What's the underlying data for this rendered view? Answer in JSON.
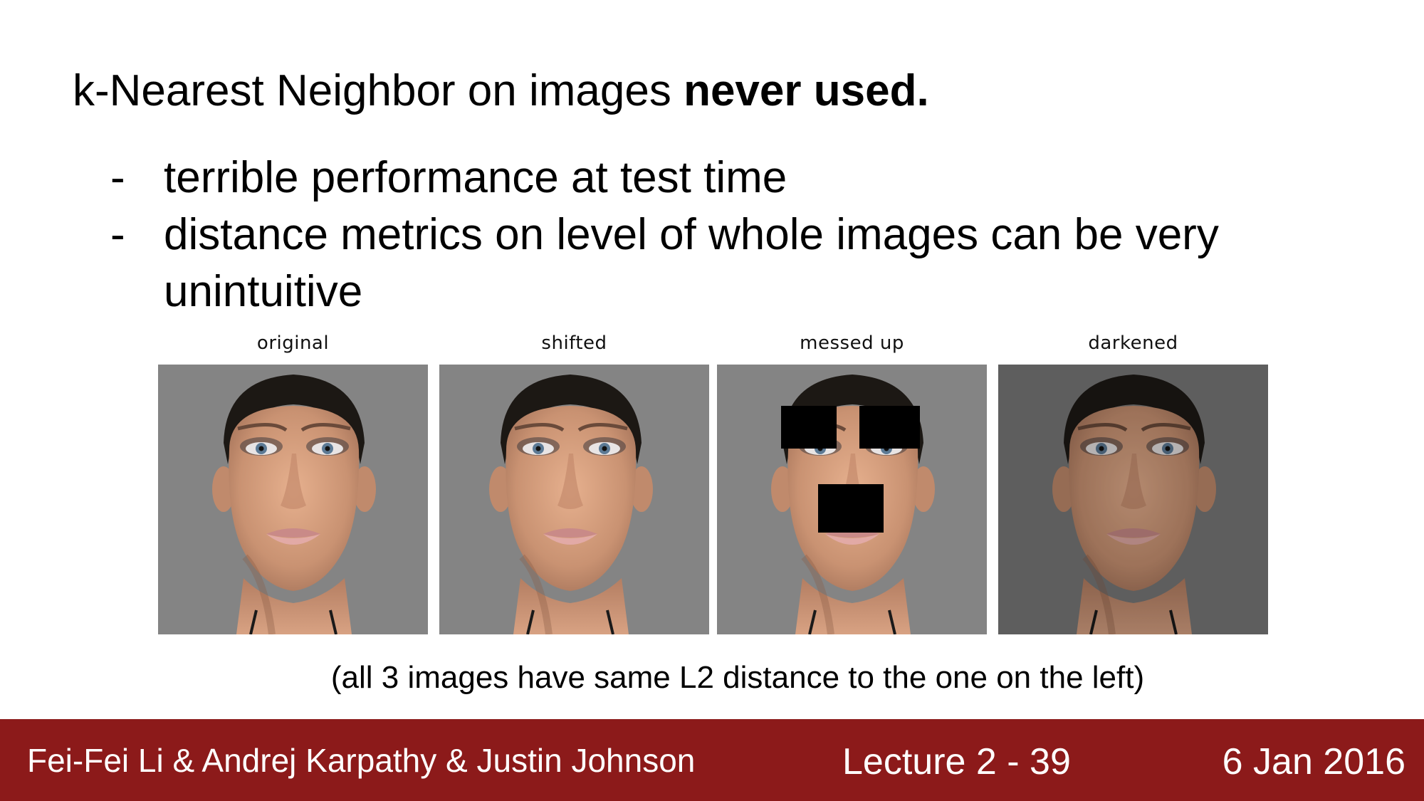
{
  "slide": {
    "title_plain": "k-Nearest Neighbor on images ",
    "title_bold": "never used.",
    "bullets": [
      {
        "dash": "-",
        "text": "terrible performance at test time"
      },
      {
        "dash": "-",
        "text": "distance metrics on level of whole images can be very unintuitive"
      }
    ],
    "images": [
      {
        "label": "original",
        "background": "#848484",
        "brightness": 1.0,
        "occluded": false
      },
      {
        "label": "shifted",
        "background": "#848484",
        "brightness": 1.0,
        "occluded": false
      },
      {
        "label": "messed up",
        "background": "#848484",
        "brightness": 1.0,
        "occluded": true
      },
      {
        "label": "darkened",
        "background": "#5e5e5e",
        "brightness": 0.78,
        "occluded": false
      }
    ],
    "caption": "(all 3 images have same L2 distance to the one on the left)"
  },
  "footer": {
    "authors": "Fei-Fei Li & Andrej Karpathy & Justin Johnson",
    "lecture": "Lecture 2 - 39",
    "date": "6 Jan 2016",
    "color": "#8c1a1a"
  }
}
